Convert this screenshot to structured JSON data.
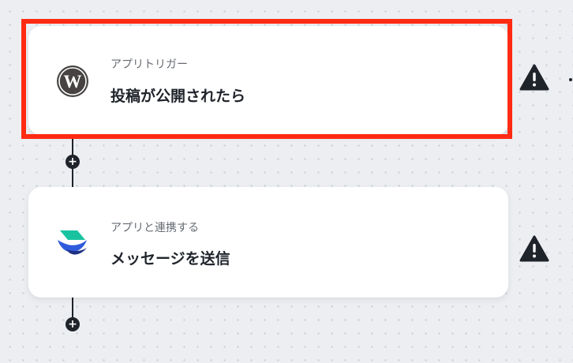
{
  "steps": [
    {
      "subtitle": "アプリトリガー",
      "title": "投稿が公開されたら",
      "icon": "wordpress-icon"
    },
    {
      "subtitle": "アプリと連携する",
      "title": "メッセージを送信",
      "icon": "bird-messaging-app-icon"
    }
  ],
  "add_step_symbol": "+",
  "warning_icon": "warning-triangle-icon",
  "colors": {
    "highlight": "#ff2a12",
    "connector": "#1f232a",
    "background": "#eceef2"
  }
}
